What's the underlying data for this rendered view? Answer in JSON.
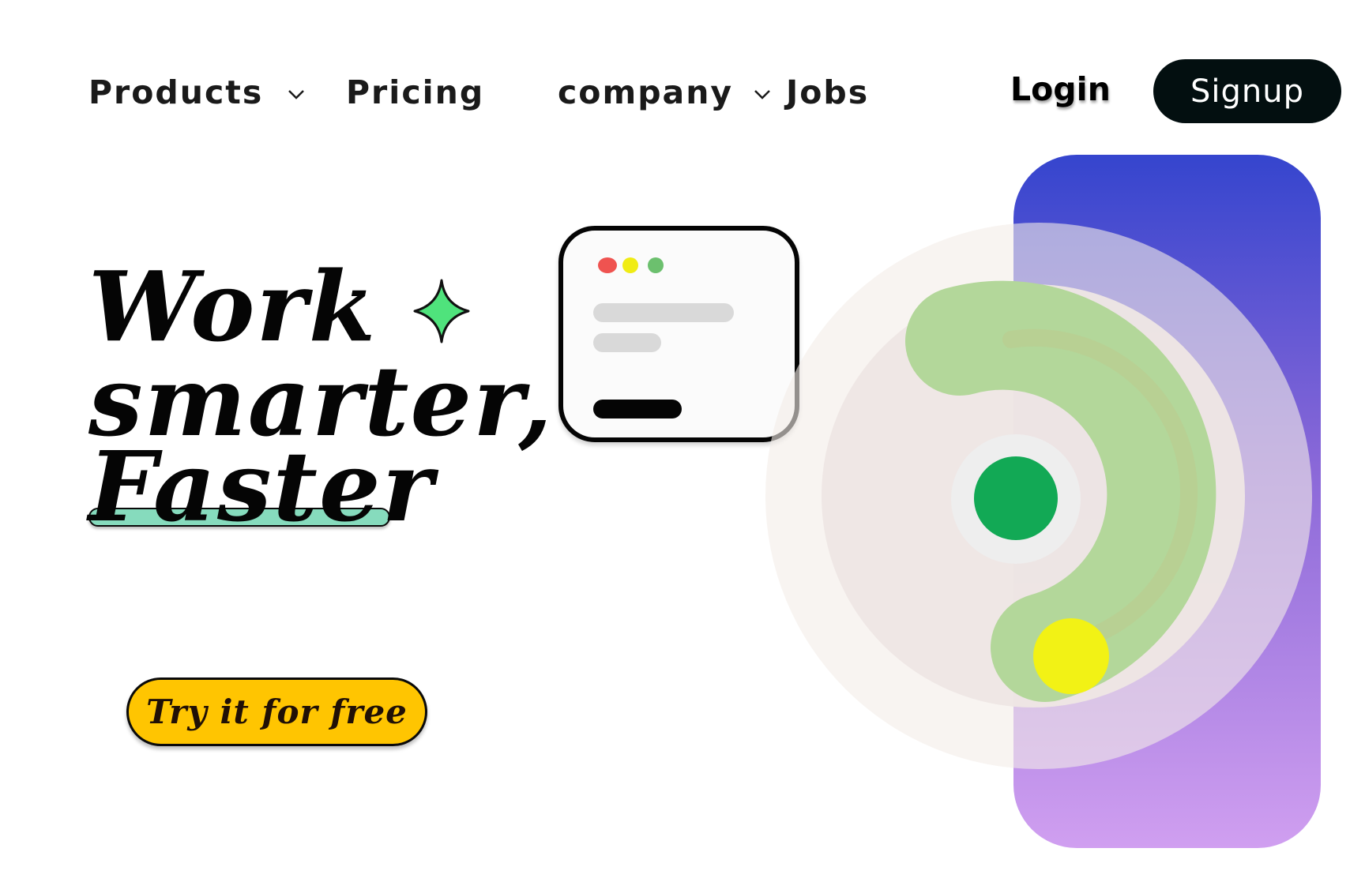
{
  "nav": {
    "products": "Products",
    "pricing": "Pricing",
    "company": "company",
    "jobs": "Jobs",
    "login": "Login",
    "signup": "Signup"
  },
  "hero": {
    "line1": "Work",
    "line2": "smarter,",
    "line3": "Faster",
    "cta": "Try it for free"
  },
  "colors": {
    "signup_bg": "#030f10",
    "cta_bg": "#ffc501",
    "underline": "#86dbbd",
    "sparkle": "#4fe37c",
    "gradient_top": "#3545ce",
    "gradient_bottom": "#d09ff0",
    "arc": "#b3d79a",
    "center_dot": "#12a955",
    "knob": "#f2f215"
  },
  "icons": [
    "chevron-down-icon",
    "sparkle-icon",
    "window-dot-red",
    "window-dot-yellow",
    "window-dot-green"
  ]
}
